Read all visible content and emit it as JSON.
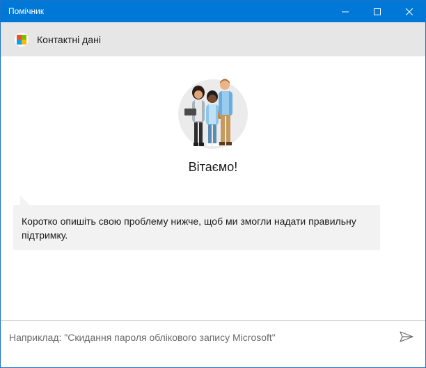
{
  "window": {
    "title": "Помічник"
  },
  "header": {
    "title": "Контактні дані",
    "logo": "microsoft-logo"
  },
  "main": {
    "welcome": "Вітаємо!",
    "message": "Коротко опишіть свою проблему нижче, щоб ми змогли надати правильну підтримку."
  },
  "input": {
    "placeholder": "Наприклад: \"Скидання пароля облікового запису Microsoft\"",
    "value": ""
  },
  "icons": {
    "minimize": "minimize-icon",
    "maximize": "maximize-icon",
    "close": "close-icon",
    "send": "send-icon"
  },
  "colors": {
    "titlebar": "#0078d7",
    "header": "#e6e6e6",
    "bubble": "#f2f2f2"
  }
}
